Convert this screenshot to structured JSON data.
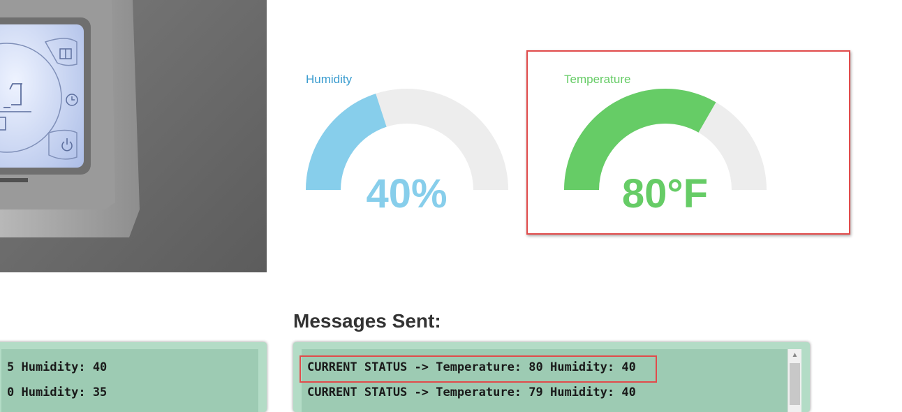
{
  "photo": {
    "icon_names": [
      "book-icon",
      "clock-icon",
      "power-icon"
    ]
  },
  "gauges": {
    "humidity": {
      "title": "Humidity",
      "value_text": "40%",
      "value": 40,
      "min": 0,
      "max": 100,
      "color": "#87ceeb"
    },
    "temperature": {
      "title": "Temperature",
      "value_text": "80°F",
      "value": 80,
      "min": 0,
      "max": 120,
      "color": "#66cc66"
    }
  },
  "track_color": "#ededed",
  "highlight_color": "#e14b4b",
  "messages_sent": {
    "title": "Messages Sent:",
    "lines": [
      "CURRENT STATUS -> Temperature: 80 Humidity: 40",
      "CURRENT STATUS -> Temperature: 79 Humidity: 40"
    ]
  },
  "left_panel": {
    "lines": [
      "5 Humidity: 40",
      "0 Humidity: 35"
    ]
  }
}
